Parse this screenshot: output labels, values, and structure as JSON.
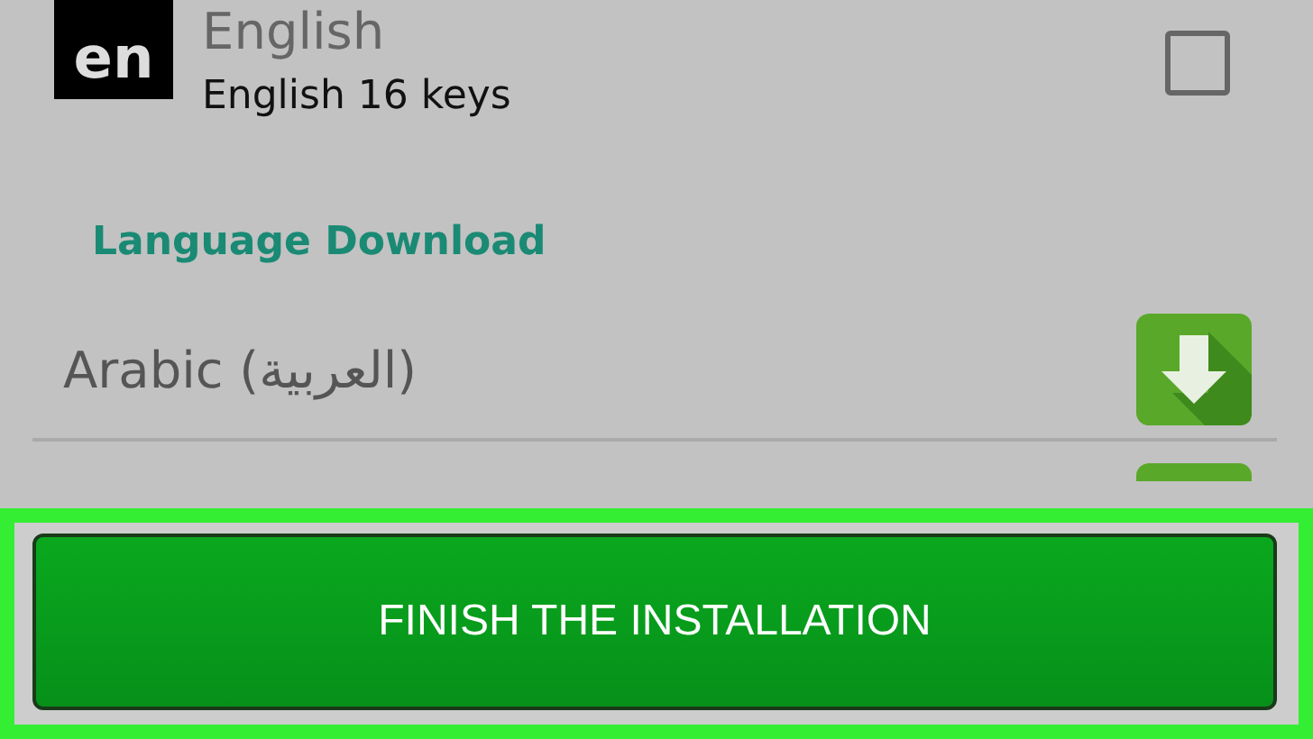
{
  "installed_languages": [
    {
      "code": "en",
      "name": "English",
      "layout": "English 16 keys",
      "checked": false
    }
  ],
  "section_heading": "Language Download",
  "downloads": [
    {
      "name": "Arabic (العربية)"
    }
  ],
  "button": "FINISH THE INSTALLATION"
}
